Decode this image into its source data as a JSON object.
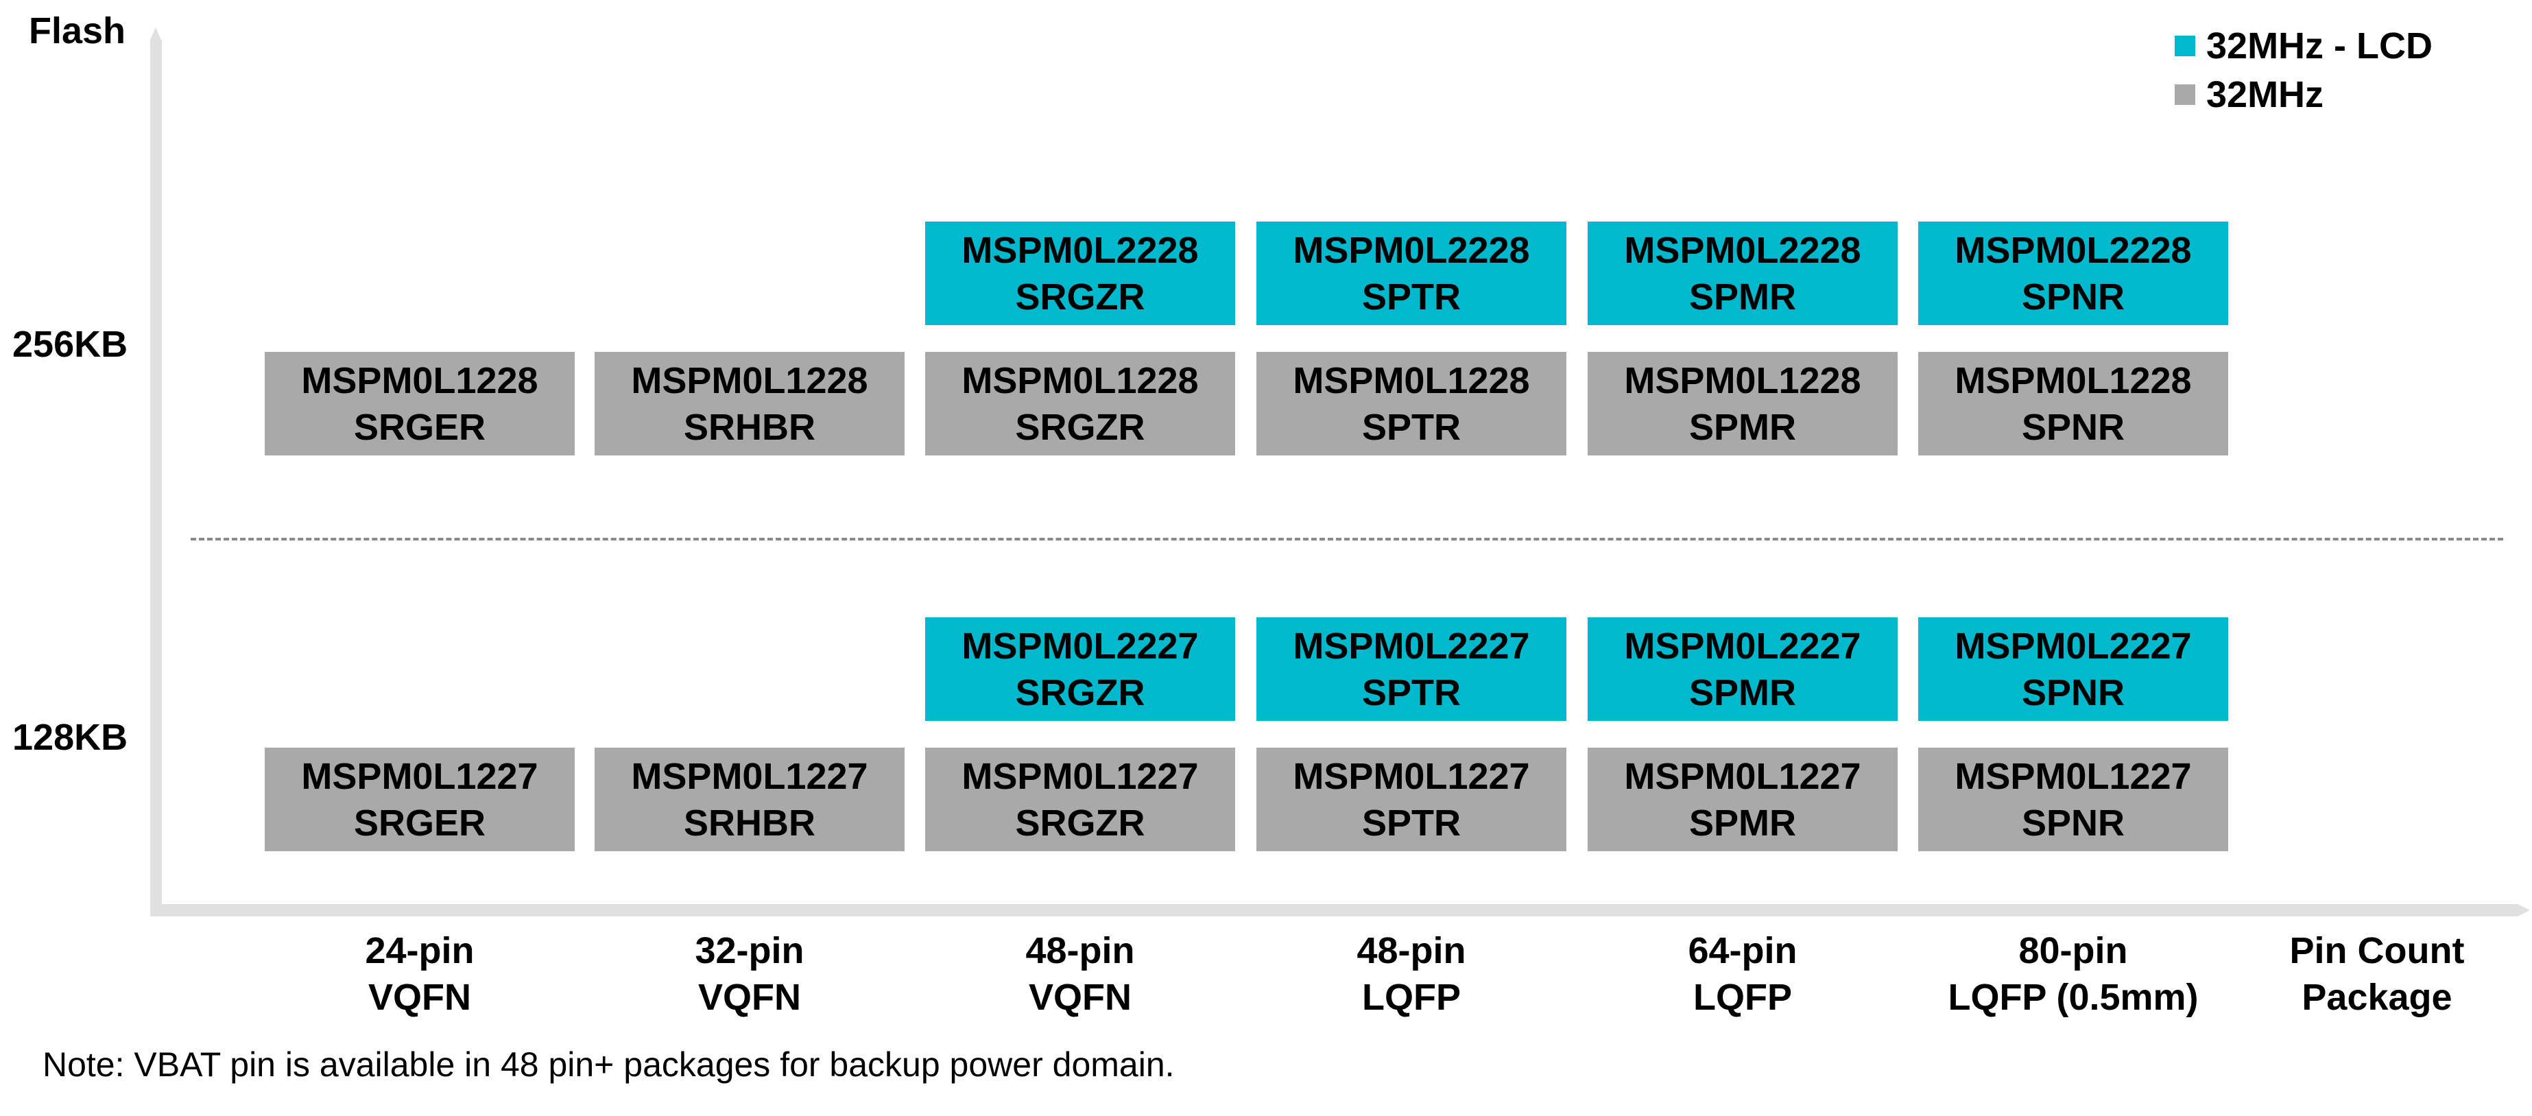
{
  "colors": {
    "lcd": "#00b9cc",
    "standard": "#a9a9a9",
    "axis": "#e0e0e0",
    "divider": "#8a8a8a"
  },
  "y_axis": {
    "title": "Flash",
    "levels": [
      "256KB",
      "128KB"
    ]
  },
  "x_axis": {
    "title_line1": "Pin Count",
    "title_line2": "Package",
    "columns": [
      {
        "pins": "24-pin",
        "package": "VQFN"
      },
      {
        "pins": "32-pin",
        "package": "VQFN"
      },
      {
        "pins": "48-pin",
        "package": "VQFN"
      },
      {
        "pins": "48-pin",
        "package": "LQFP"
      },
      {
        "pins": "64-pin",
        "package": "LQFP"
      },
      {
        "pins": "80-pin",
        "package": "LQFP (0.5mm)"
      }
    ]
  },
  "legend": [
    {
      "label": "32MHz - LCD",
      "type": "lcd"
    },
    {
      "label": "32MHz",
      "type": "standard"
    }
  ],
  "parts": [
    {
      "flash": "256KB",
      "type": "lcd",
      "col": 2,
      "name": "MSPM0L2228",
      "suffix": "SRGZR"
    },
    {
      "flash": "256KB",
      "type": "lcd",
      "col": 3,
      "name": "MSPM0L2228",
      "suffix": "SPTR"
    },
    {
      "flash": "256KB",
      "type": "lcd",
      "col": 4,
      "name": "MSPM0L2228",
      "suffix": "SPMR"
    },
    {
      "flash": "256KB",
      "type": "lcd",
      "col": 5,
      "name": "MSPM0L2228",
      "suffix": "SPNR"
    },
    {
      "flash": "256KB",
      "type": "standard",
      "col": 0,
      "name": "MSPM0L1228",
      "suffix": "SRGER"
    },
    {
      "flash": "256KB",
      "type": "standard",
      "col": 1,
      "name": "MSPM0L1228",
      "suffix": "SRHBR"
    },
    {
      "flash": "256KB",
      "type": "standard",
      "col": 2,
      "name": "MSPM0L1228",
      "suffix": "SRGZR"
    },
    {
      "flash": "256KB",
      "type": "standard",
      "col": 3,
      "name": "MSPM0L1228",
      "suffix": "SPTR"
    },
    {
      "flash": "256KB",
      "type": "standard",
      "col": 4,
      "name": "MSPM0L1228",
      "suffix": "SPMR"
    },
    {
      "flash": "256KB",
      "type": "standard",
      "col": 5,
      "name": "MSPM0L1228",
      "suffix": "SPNR"
    },
    {
      "flash": "128KB",
      "type": "lcd",
      "col": 2,
      "name": "MSPM0L2227",
      "suffix": "SRGZR"
    },
    {
      "flash": "128KB",
      "type": "lcd",
      "col": 3,
      "name": "MSPM0L2227",
      "suffix": "SPTR"
    },
    {
      "flash": "128KB",
      "type": "lcd",
      "col": 4,
      "name": "MSPM0L2227",
      "suffix": "SPMR"
    },
    {
      "flash": "128KB",
      "type": "lcd",
      "col": 5,
      "name": "MSPM0L2227",
      "suffix": "SPNR"
    },
    {
      "flash": "128KB",
      "type": "standard",
      "col": 0,
      "name": "MSPM0L1227",
      "suffix": "SRGER"
    },
    {
      "flash": "128KB",
      "type": "standard",
      "col": 1,
      "name": "MSPM0L1227",
      "suffix": "SRHBR"
    },
    {
      "flash": "128KB",
      "type": "standard",
      "col": 2,
      "name": "MSPM0L1227",
      "suffix": "SRGZR"
    },
    {
      "flash": "128KB",
      "type": "standard",
      "col": 3,
      "name": "MSPM0L1227",
      "suffix": "SPTR"
    },
    {
      "flash": "128KB",
      "type": "standard",
      "col": 4,
      "name": "MSPM0L1227",
      "suffix": "SPMR"
    },
    {
      "flash": "128KB",
      "type": "standard",
      "col": 5,
      "name": "MSPM0L1227",
      "suffix": "SPNR"
    }
  ],
  "note": "Note: VBAT pin is available in 48 pin+ packages for backup power domain."
}
